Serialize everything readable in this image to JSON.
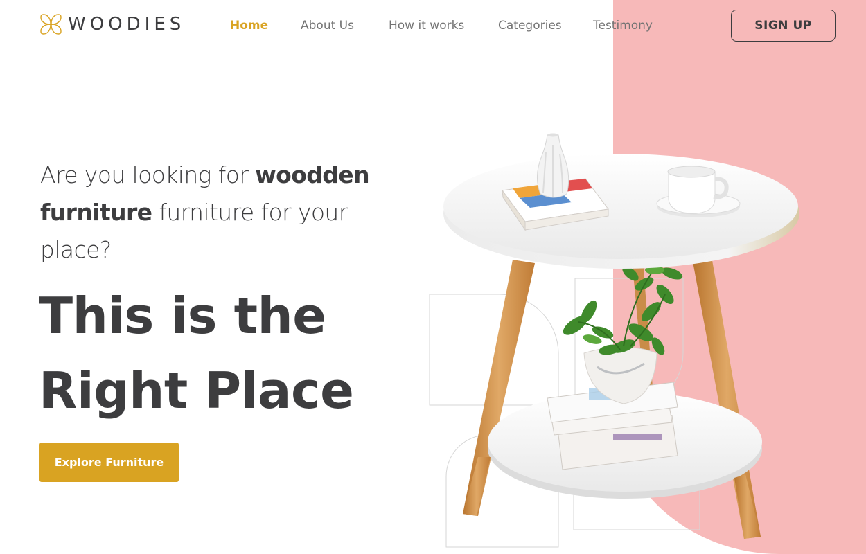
{
  "brand": {
    "name": "WOODIES",
    "accent_color": "#d9a322",
    "panel_color": "#f7b9b9",
    "text_color": "#3d3d3f"
  },
  "nav": {
    "items": [
      {
        "label": "Home",
        "active": true
      },
      {
        "label": "About Us",
        "active": false
      },
      {
        "label": "How it works",
        "active": false
      },
      {
        "label": "Categories",
        "active": false
      },
      {
        "label": "Testimony",
        "active": false
      }
    ],
    "signup_label": "SIGN UP"
  },
  "hero": {
    "subtitle_part1": "Are you looking for ",
    "subtitle_bold": "woodden furniture",
    "subtitle_part2": " furniture for your place?",
    "title_line1": "This is the",
    "title_line2": "Right Place",
    "cta_label": "Explore Furniture"
  },
  "icons": {
    "logo": "four-petal-flower-icon"
  },
  "image": {
    "subject": "round-white-side-table-with-wooden-legs-vase-books-cup-and-plant"
  }
}
